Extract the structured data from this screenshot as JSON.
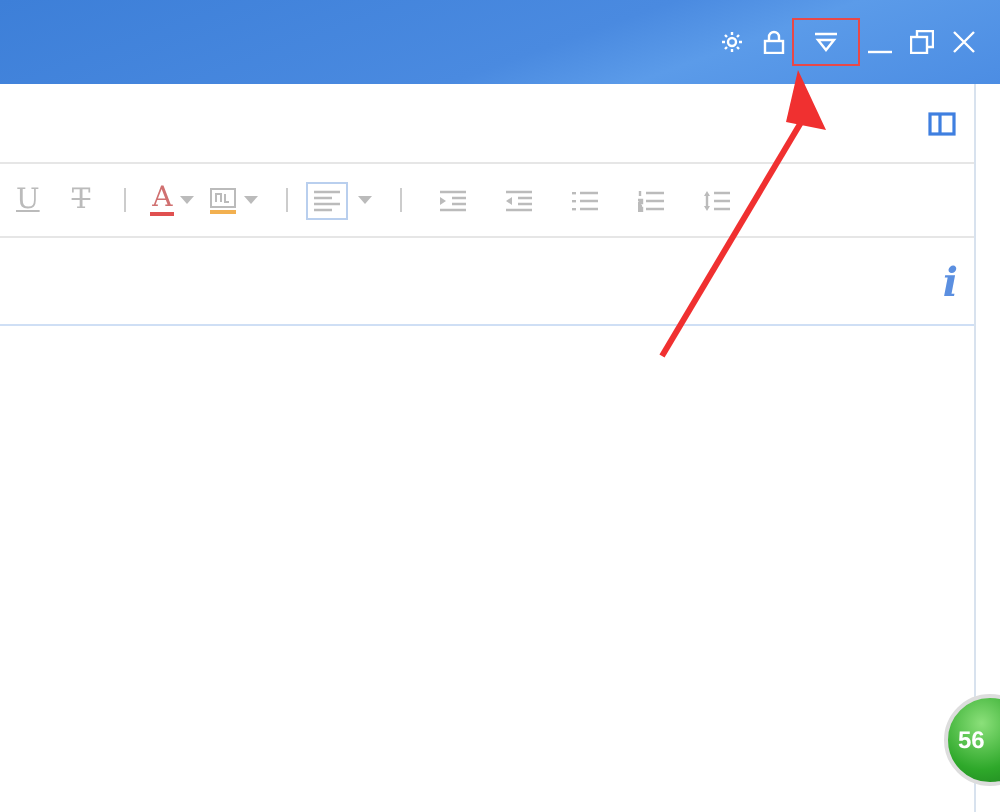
{
  "title_bar": {
    "buttons": [
      {
        "kind": "settings",
        "highlighted": false
      },
      {
        "kind": "lock",
        "highlighted": false
      },
      {
        "kind": "dropdown",
        "highlighted": true
      },
      {
        "kind": "minimize",
        "highlighted": false
      },
      {
        "kind": "restore",
        "highlighted": false
      },
      {
        "kind": "close",
        "highlighted": false
      }
    ]
  },
  "toolbar": {
    "items": [
      {
        "kind": "underline",
        "label": "U"
      },
      {
        "kind": "strike",
        "label": "T"
      },
      {
        "kind": "separator"
      },
      {
        "kind": "font-color",
        "label": "A"
      },
      {
        "kind": "highlight"
      },
      {
        "kind": "separator"
      },
      {
        "kind": "align",
        "selected": true
      },
      {
        "kind": "separator"
      },
      {
        "kind": "indent"
      },
      {
        "kind": "outdent"
      },
      {
        "kind": "bullets"
      },
      {
        "kind": "numbers"
      },
      {
        "kind": "spacing"
      }
    ]
  },
  "info_label": "i",
  "floating_badge": {
    "text": "56"
  }
}
